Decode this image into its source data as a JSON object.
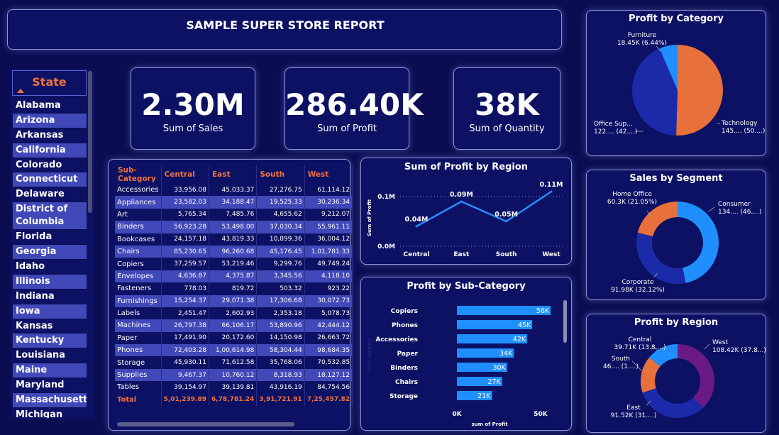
{
  "title": "SAMPLE SUPER STORE REPORT",
  "kpis": [
    {
      "value": "2.30M",
      "label": "Sum of Sales"
    },
    {
      "value": "286.40K",
      "label": "Sum of Profit"
    },
    {
      "value": "38K",
      "label": "Sum of Quantity"
    }
  ],
  "state_slicer": {
    "header": "State",
    "items": [
      "Alabama",
      "Arizona",
      "Arkansas",
      "California",
      "Colorado",
      "Connecticut",
      "Delaware",
      "District of Columbia",
      "Florida",
      "Georgia",
      "Idaho",
      "Illinois",
      "Indiana",
      "Iowa",
      "Kansas",
      "Kentucky",
      "Louisiana",
      "Maine",
      "Maryland",
      "Massachusetts",
      "Michigan"
    ]
  },
  "table": {
    "columns": [
      "Sub-Category",
      "Central",
      "East",
      "South",
      "West"
    ],
    "rows": [
      [
        "Accessories",
        "33,956.08",
        "45,033.37",
        "27,276.75",
        "61,114.12"
      ],
      [
        "Appliances",
        "23,582.03",
        "34,188.47",
        "19,525.33",
        "30,236.34"
      ],
      [
        "Art",
        "5,765.34",
        "7,485.76",
        "4,655.62",
        "9,212.07"
      ],
      [
        "Binders",
        "56,923.28",
        "53,498.00",
        "37,030.34",
        "55,961.11"
      ],
      [
        "Bookcases",
        "24,157.18",
        "43,819.33",
        "10,899.36",
        "36,004.12"
      ],
      [
        "Chairs",
        "85,230.65",
        "96,260.68",
        "45,176.45",
        "1,01,781.33"
      ],
      [
        "Copiers",
        "37,259.57",
        "53,219.46",
        "9,299.76",
        "49,749.24"
      ],
      [
        "Envelopes",
        "4,636.87",
        "4,375.87",
        "3,345.56",
        "4,118.10"
      ],
      [
        "Fasteners",
        "778.03",
        "819.72",
        "503.32",
        "923.22"
      ],
      [
        "Furnishings",
        "15,254.37",
        "29,071.38",
        "17,306.68",
        "30,072.73"
      ],
      [
        "Labels",
        "2,451.47",
        "2,602.93",
        "2,353.18",
        "5,078.73"
      ],
      [
        "Machines",
        "26,797.38",
        "66,106.17",
        "53,890.96",
        "42,444.12"
      ],
      [
        "Paper",
        "17,491.90",
        "20,172.60",
        "14,150.98",
        "26,663.72"
      ],
      [
        "Phones",
        "72,403.28",
        "1,00,614.98",
        "58,304.44",
        "98,684.35"
      ],
      [
        "Storage",
        "45,930.11",
        "71,612.58",
        "35,768.06",
        "70,532.85"
      ],
      [
        "Supplies",
        "9,467.37",
        "10,760.12",
        "8,318.93",
        "18,127.12"
      ],
      [
        "Tables",
        "39,154.97",
        "39,139.81",
        "43,916.19",
        "84,754.56"
      ]
    ],
    "total": [
      "Total",
      "5,01,239.89",
      "6,78,781.24",
      "3,91,721.91",
      "7,25,457.82"
    ]
  },
  "colors": {
    "orange": "#e8703a",
    "blue": "#1f8fff",
    "navy": "#1b2aa8",
    "purple": "#6a1a86",
    "accent_blue_line": "#2a8cff"
  },
  "chart_data": [
    {
      "type": "line",
      "title": "Sum of Profit by Region",
      "ylabel": "Sum of Profit",
      "categories": [
        "Central",
        "East",
        "South",
        "West"
      ],
      "values": [
        0.04,
        0.09,
        0.05,
        0.11
      ],
      "data_labels": [
        "0.04M",
        "0.09M",
        "0.05M",
        "0.11M"
      ],
      "yticks": [
        "0.0M",
        "0.1M"
      ],
      "ylim": [
        0,
        0.12
      ]
    },
    {
      "type": "bar",
      "orientation": "horizontal",
      "title": "Profit by Sub-Category",
      "xlabel": "sum of Profit",
      "ylabel": "Sub-Category",
      "categories": [
        "Copiers",
        "Phones",
        "Accessories",
        "Paper",
        "Binders",
        "Chairs",
        "Storage"
      ],
      "values": [
        56,
        45,
        42,
        34,
        30,
        27,
        21
      ],
      "data_labels": [
        "56K",
        "45K",
        "42K",
        "34K",
        "30K",
        "27K",
        "21K"
      ],
      "xticks": [
        "0K",
        "50K"
      ],
      "xlim": [
        0,
        60
      ]
    },
    {
      "type": "pie",
      "title": "Profit by Category",
      "slices": [
        {
          "name": "Technology",
          "label": "Technology",
          "value_text": "145.... (50....)",
          "value": 50.0,
          "color": "#e8703a"
        },
        {
          "name": "Office Sup...",
          "label": "Office Sup...",
          "value_text": "122.... (42....)",
          "value": 42.6,
          "color": "#1b2aa8"
        },
        {
          "name": "Furniture",
          "label": "Furniture",
          "value_text": "18.45K (6.44%)",
          "value": 6.44,
          "color": "#1f8fff"
        }
      ]
    },
    {
      "type": "pie",
      "donut": true,
      "title": "Sales by Segment",
      "slices": [
        {
          "name": "Consumer",
          "label": "Consumer",
          "value_text": "134.... (46....)",
          "value": 46.83,
          "color": "#1f8fff"
        },
        {
          "name": "Corporate",
          "label": "Corporate",
          "value_text": "91.98K (32.12%)",
          "value": 32.12,
          "color": "#1b2aa8"
        },
        {
          "name": "Home Office",
          "label": "Home Office",
          "value_text": "60.3K (21.05%)",
          "value": 21.05,
          "color": "#e8703a"
        }
      ]
    },
    {
      "type": "pie",
      "donut": true,
      "title": "Profit by Region",
      "slices": [
        {
          "name": "West",
          "label": "West",
          "value_text": "108.42K (37.8...)",
          "value": 37.86,
          "color": "#6a1a86"
        },
        {
          "name": "East",
          "label": "East",
          "value_text": "91.52K (31....)",
          "value": 31.96,
          "color": "#1b2aa8"
        },
        {
          "name": "South",
          "label": "South",
          "value_text": "46.... (1....)",
          "value": 16.2,
          "color": "#e8703a"
        },
        {
          "name": "Central",
          "label": "Central",
          "value_text": "39.71K (13.8....)",
          "value": 13.87,
          "color": "#1f8fff"
        }
      ]
    }
  ]
}
